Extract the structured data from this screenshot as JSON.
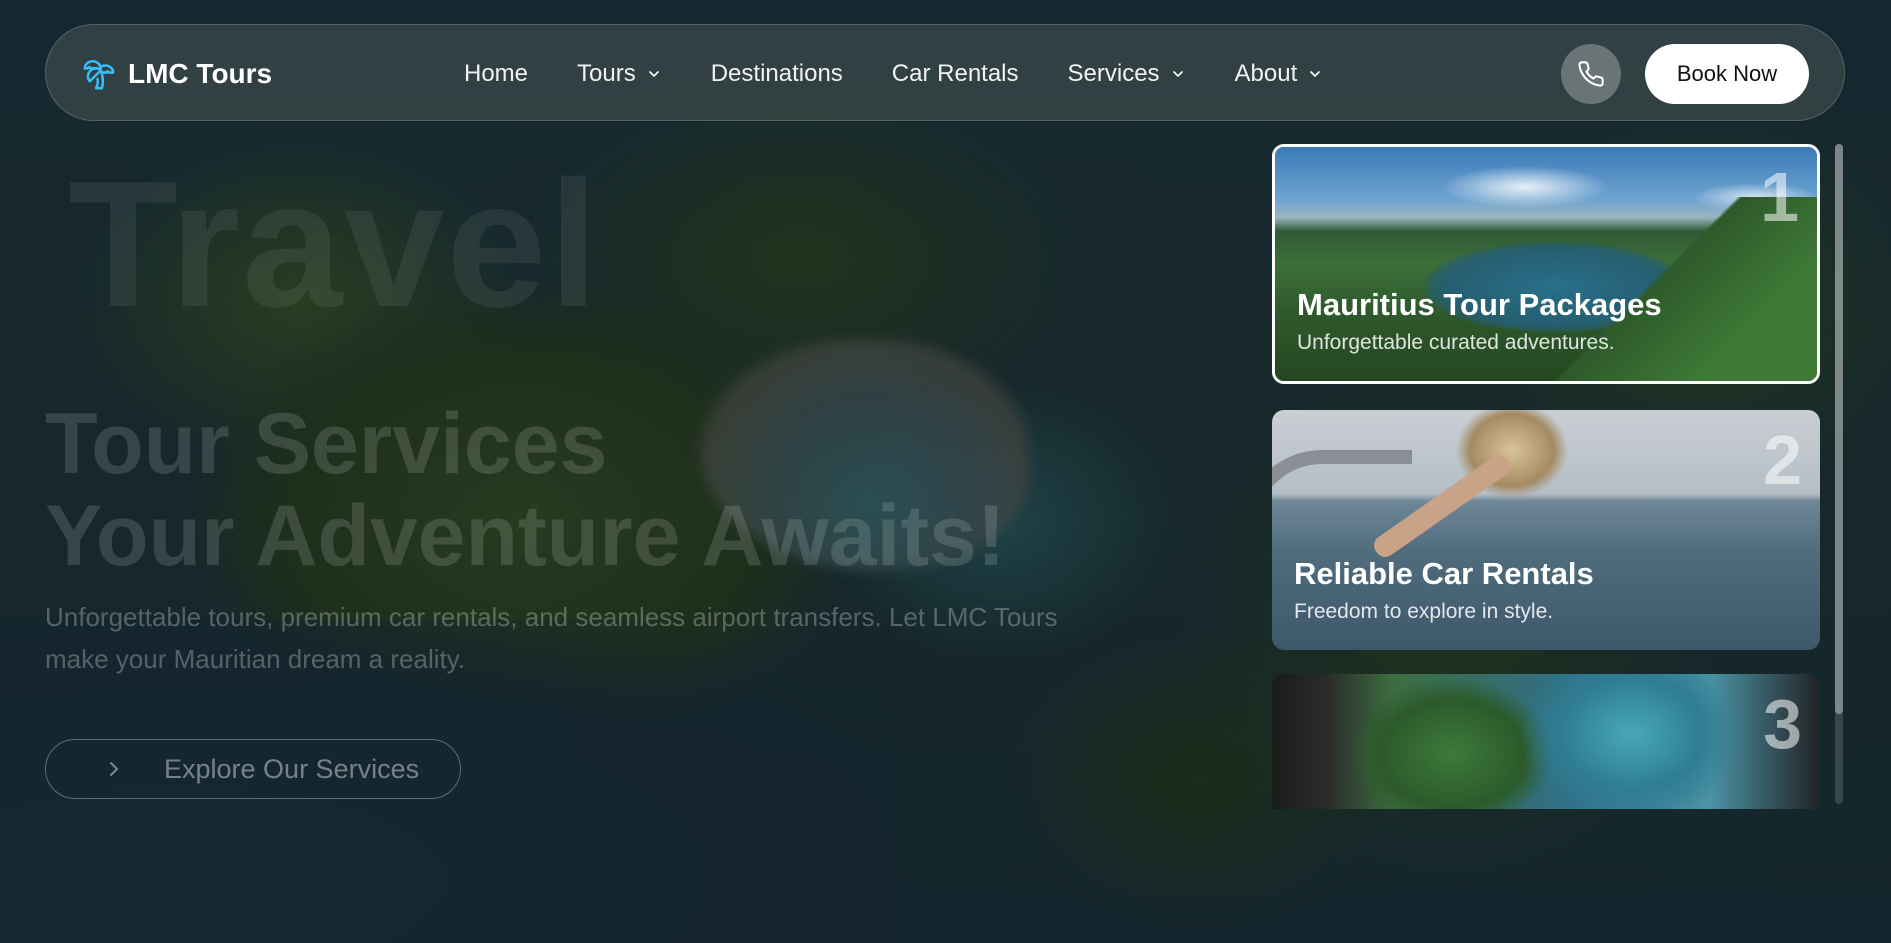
{
  "brand": {
    "name": "LMC Tours",
    "icon": "palm-tree-icon"
  },
  "nav": {
    "items": [
      {
        "label": "Home",
        "has_dropdown": false
      },
      {
        "label": "Tours",
        "has_dropdown": true
      },
      {
        "label": "Destinations",
        "has_dropdown": false
      },
      {
        "label": "Car Rentals",
        "has_dropdown": false
      },
      {
        "label": "Services",
        "has_dropdown": true
      },
      {
        "label": "About",
        "has_dropdown": true
      }
    ],
    "phone_icon": "phone-icon",
    "cta_label": "Book Now"
  },
  "hero": {
    "background_word": "Travel",
    "title_line1": "Tour Services",
    "title_line2": "Your Adventure Awaits!",
    "subtitle": "Unforgettable tours, premium car rentals, and seamless airport transfers. Let LMC Tours make your Mauritian dream a reality.",
    "cta_label": "Explore Our Services",
    "cta_icon": "chevron-right-icon"
  },
  "cards": [
    {
      "number": "1",
      "title": "Mauritius Tour Packages",
      "description": "Unforgettable curated adventures.",
      "active": true
    },
    {
      "number": "2",
      "title": "Reliable Car Rentals",
      "description": "Freedom to explore in style.",
      "active": false
    },
    {
      "number": "3",
      "title": "",
      "description": "",
      "active": false
    }
  ],
  "colors": {
    "accent": "#38bdf8",
    "cta_bg": "#ffffff",
    "cta_text": "#111111"
  }
}
